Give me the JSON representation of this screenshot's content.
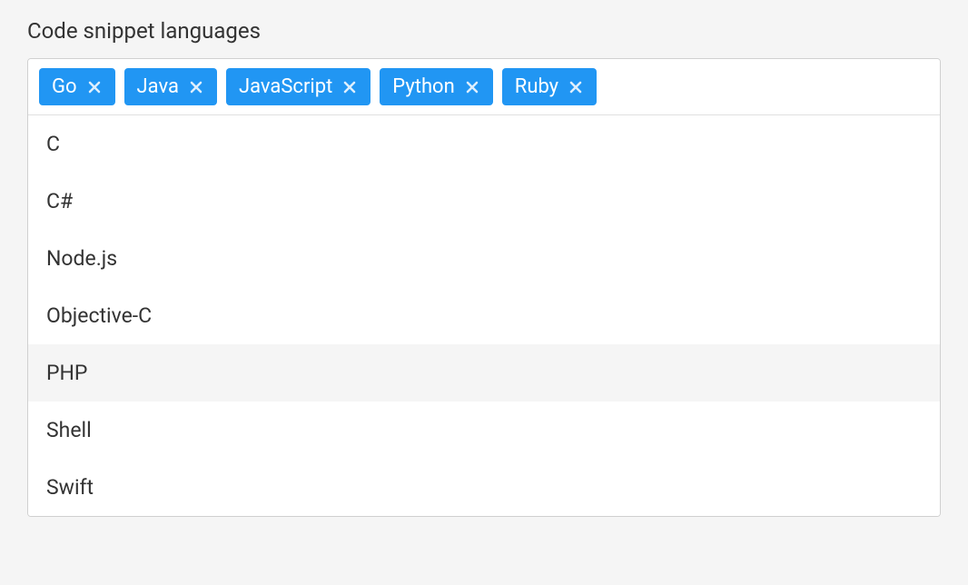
{
  "field": {
    "label": "Code snippet languages"
  },
  "selected_tags": [
    {
      "label": "Go"
    },
    {
      "label": "Java"
    },
    {
      "label": "JavaScript"
    },
    {
      "label": "Python"
    },
    {
      "label": "Ruby"
    }
  ],
  "options": [
    {
      "label": "C",
      "highlighted": false
    },
    {
      "label": "C#",
      "highlighted": false
    },
    {
      "label": "Node.js",
      "highlighted": false
    },
    {
      "label": "Objective-C",
      "highlighted": false
    },
    {
      "label": "PHP",
      "highlighted": true
    },
    {
      "label": "Shell",
      "highlighted": false
    },
    {
      "label": "Swift",
      "highlighted": false
    }
  ],
  "colors": {
    "tag_bg": "#2196f3",
    "tag_text": "#ffffff"
  }
}
